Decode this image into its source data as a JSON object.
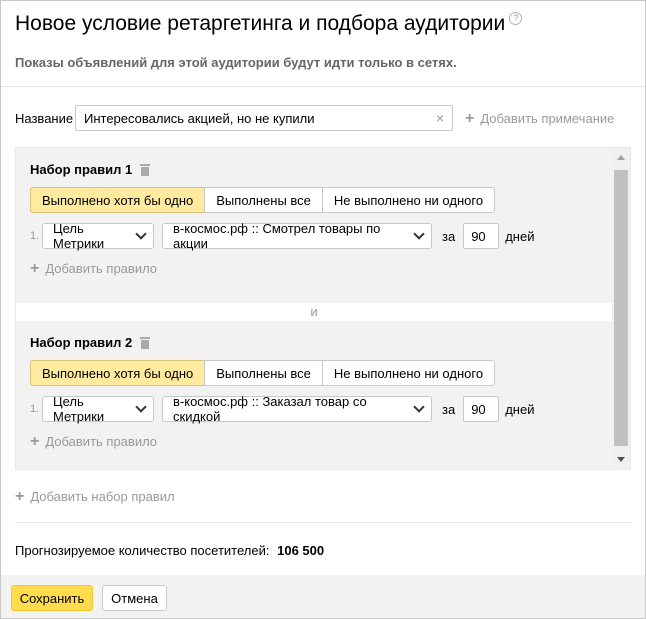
{
  "header": {
    "title": "Новое условие ретаргетинга и подбора аудитории",
    "help_icon": "?",
    "subtitle": "Показы объявлений для этой аудитории будут идти только в сетях."
  },
  "name_field": {
    "label": "Название",
    "value": "Интересовались акцией, но не купили",
    "clear_icon": "×",
    "add_note_label": "Добавить примечание"
  },
  "rule_sets": [
    {
      "title": "Набор правил 1",
      "modes": [
        "Выполнено хотя бы одно",
        "Выполнены все",
        "Не выполнено ни одного"
      ],
      "active_mode": 0,
      "rules": [
        {
          "num": "1.",
          "goal_type": "Цель Метрики",
          "event": "в-космос.рф :: Смотрел товары по акции",
          "za": "за",
          "days": "90",
          "days_label": "дней"
        }
      ],
      "add_rule_label": "Добавить правило"
    },
    {
      "title": "Набор правил 2",
      "modes": [
        "Выполнено хотя бы одно",
        "Выполнены все",
        "Не выполнено ни одного"
      ],
      "active_mode": 0,
      "rules": [
        {
          "num": "1.",
          "goal_type": "Цель Метрики",
          "event": "в-космос.рф :: Заказал товар со скидкой",
          "za": "за",
          "days": "90",
          "days_label": "дней"
        }
      ],
      "add_rule_label": "Добавить правило"
    }
  ],
  "and_separator": "и",
  "add_set_label": "Добавить набор правил",
  "forecast": {
    "label": "Прогнозируемое количество посетителей:",
    "value": "106 500"
  },
  "footer": {
    "save_label": "Сохранить",
    "cancel_label": "Отмена"
  },
  "colors": {
    "active_mode": "#ffeba0",
    "save_button": "#ffdb4d",
    "muted_text": "#999999"
  }
}
